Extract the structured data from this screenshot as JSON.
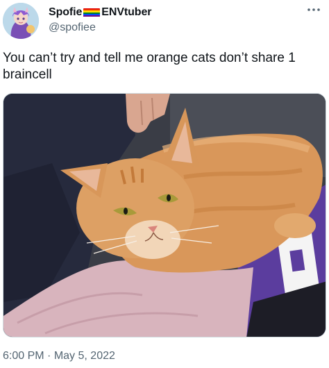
{
  "user": {
    "display_name_part1": "Spofie",
    "display_name_part2": "ENVtuber",
    "flag_icon": "rainbow-flag-emoji",
    "handle": "@spofiee"
  },
  "tweet": {
    "text": "You can’t try and tell me orange cats don’t share 1 braincell",
    "image_icon": "orange-cat-photo"
  },
  "footer": {
    "time": "6:00 PM",
    "separator": "·",
    "date": "May 5, 2022"
  },
  "colors": {
    "text_primary": "#0f1419",
    "text_secondary": "#536471",
    "border": "#cfd9de"
  }
}
